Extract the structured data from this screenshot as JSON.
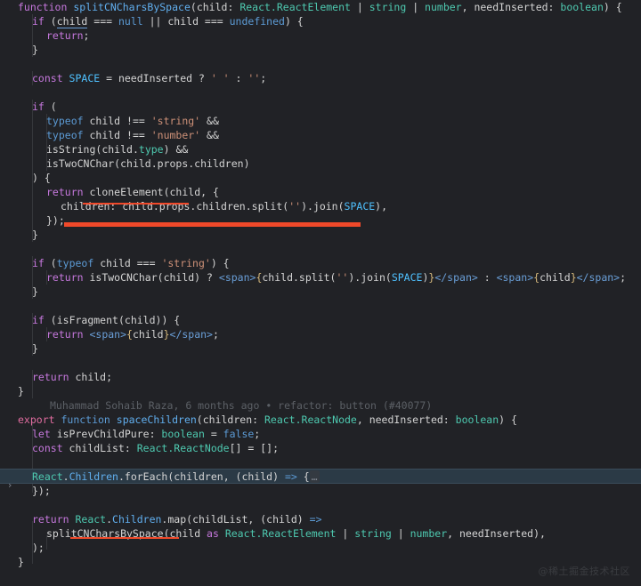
{
  "editor": {
    "theme_background": "#212226",
    "default_text_color": "#d4d4d4",
    "highlight_line_color": "#2b3a46",
    "error_marker_color": "#f0492a",
    "blame_text_color": "#5c6066",
    "fold_chevron": "›"
  },
  "blame": {
    "author": "Muhammad Sohaib Raza",
    "age": "6 months ago",
    "separator": "•",
    "message": "refactor: button (#40077)",
    "full": "Muhammad Sohaib Raza, 6 months ago • refactor: button (#40077)"
  },
  "watermark": {
    "text": "@稀土掘金技术社区"
  },
  "code": {
    "l1_function": "function",
    "l1_name": "splitCNCharsBySpace",
    "l1_open": "(",
    "l1_child": "child",
    "l1_colon": ": ",
    "l1_type1": "React.ReactElement",
    "l1_pipe1": " | ",
    "l1_type2": "string",
    "l1_pipe2": " | ",
    "l1_type3": "number",
    "l1_comma": ", ",
    "l1_need": "needInserted",
    "l1_colon2": ": ",
    "l1_bool": "boolean",
    "l1_close": ") {",
    "l2_if": "if",
    "l2_open": " (",
    "l2_child1": "child",
    "l2_eq1": " === ",
    "l2_null": "null",
    "l2_or": " || ",
    "l2_child2": "child",
    "l2_eq2": " === ",
    "l2_undef": "undefined",
    "l2_close": ") {",
    "l3_return": "return",
    "l3_semi": ";",
    "l4_brace": "}",
    "l6_const": "const",
    "l6_space": " SPACE",
    "l6_eq": " = ",
    "l6_need": "needInserted",
    "l6_q": " ? ",
    "l6_str1": "' '",
    "l6_colon": " : ",
    "l6_str2": "''",
    "l6_semi": ";",
    "l8_if": "if",
    "l8_paren": " (",
    "l9_typeof": "typeof",
    "l9_child": " child ",
    "l9_neq": "!== ",
    "l9_str": "'string'",
    "l9_and": " &&",
    "l10_typeof": "typeof",
    "l10_child": " child ",
    "l10_neq": "!== ",
    "l10_str": "'number'",
    "l10_and": " &&",
    "l11_fn": "isString",
    "l11_open": "(",
    "l11_child": "child",
    "l11_dot": ".",
    "l11_type": "type",
    "l11_close": ")",
    "l11_and": " &&",
    "l12_fn": "isTwoCNChar",
    "l12_args": "(child.props.children)",
    "l13_close": ") {",
    "l14_return": "return",
    "l14_fn": " cloneElement",
    "l14_open": "(",
    "l14_child": "child",
    "l14_rest": ", {",
    "l15_key": "children",
    "l15_colon": ": ",
    "l15_expr": "child.props.children.split",
    "l15_open": "(",
    "l15_str": "''",
    "l15_mid": ").join",
    "l15_open2": "(",
    "l15_space": "SPACE",
    "l15_close": "),",
    "l16_close": "});",
    "l17_brace": "}",
    "l19_if": "if",
    "l19_open": " (",
    "l19_typeof": "typeof",
    "l19_child": " child ",
    "l19_eq": "=== ",
    "l19_str": "'string'",
    "l19_close": ") {",
    "l20_return": "return",
    "l20_fn": " isTwoCNChar",
    "l20_args": "(child)",
    "l20_q": " ? ",
    "l20_tag_open": "<span>",
    "l20_brace_open": "{",
    "l20_expr": "child.split",
    "l20_p1": "(",
    "l20_str": "''",
    "l20_mid": ").join",
    "l20_p2": "(",
    "l20_space": "SPACE",
    "l20_p3": ")",
    "l20_brace_close": "}",
    "l20_tag_close": "</span>",
    "l20_colon": " : ",
    "l20_tag_open2": "<span>",
    "l20_brace_open2": "{",
    "l20_child2": "child",
    "l20_brace_close2": "}",
    "l20_tag_close2": "</span>",
    "l20_semi": ";",
    "l21_brace": "}",
    "l23_if": "if",
    "l23_open": " (",
    "l23_fn": "isFragment",
    "l23_args": "(child)",
    "l23_close": ") {",
    "l24_return": "return",
    "l24_tag_open": " <span>",
    "l24_brace_open": "{",
    "l24_child": "child",
    "l24_brace_close": "}",
    "l24_tag_close": "</span>",
    "l24_semi": ";",
    "l25_brace": "}",
    "l27_return": "return",
    "l27_child": " child",
    "l27_semi": ";",
    "l28_brace": "}",
    "l30_export": "export",
    "l30_function": " function",
    "l30_name": " spaceChildren",
    "l30_open": "(",
    "l30_children": "children",
    "l30_colon": ": ",
    "l30_type": "React.ReactNode",
    "l30_comma": ", ",
    "l30_need": "needInserted",
    "l30_colon2": ": ",
    "l30_bool": "boolean",
    "l30_close": ") {",
    "l31_let": "let",
    "l31_name": " isPrevChildPure",
    "l31_colon": ": ",
    "l31_type": "boolean",
    "l31_eq": " = ",
    "l31_false": "false",
    "l31_semi": ";",
    "l32_const": "const",
    "l32_name": " childList",
    "l32_colon": ": ",
    "l32_type": "React.ReactNode",
    "l32_brackets": "[]",
    "l32_eq": " = ",
    "l32_empty": "[]",
    "l32_semi": ";",
    "l34_obj": "React",
    "l34_dot1": ".",
    "l34_children": "Children",
    "l34_dot2": ".",
    "l34_method": "forEach",
    "l34_open": "(",
    "l34_arg": "children",
    "l34_comma": ", ",
    "l34_paren": "(child) ",
    "l34_arrow": "=>",
    "l34_brace": " {",
    "l34_fold": "…",
    "l35_close": "});",
    "l37_return": "return",
    "l37_obj": " React",
    "l37_dot1": ".",
    "l37_children": "Children",
    "l37_dot2": ".",
    "l37_method": "map",
    "l37_open": "(",
    "l37_arg": "childList",
    "l37_comma": ", ",
    "l37_paren": "(child) ",
    "l37_arrow": "=>",
    "l38_fn": "splitCNCharsBySpace",
    "l38_open": "(",
    "l38_child": "child ",
    "l38_as": "as",
    "l38_type1": " React.ReactElement",
    "l38_pipe1": " | ",
    "l38_type2": "string",
    "l38_pipe2": " | ",
    "l38_type3": "number",
    "l38_comma": ", ",
    "l38_need": "needInserted",
    "l38_close": "),",
    "l39_close": ");",
    "l40_brace": "}"
  }
}
